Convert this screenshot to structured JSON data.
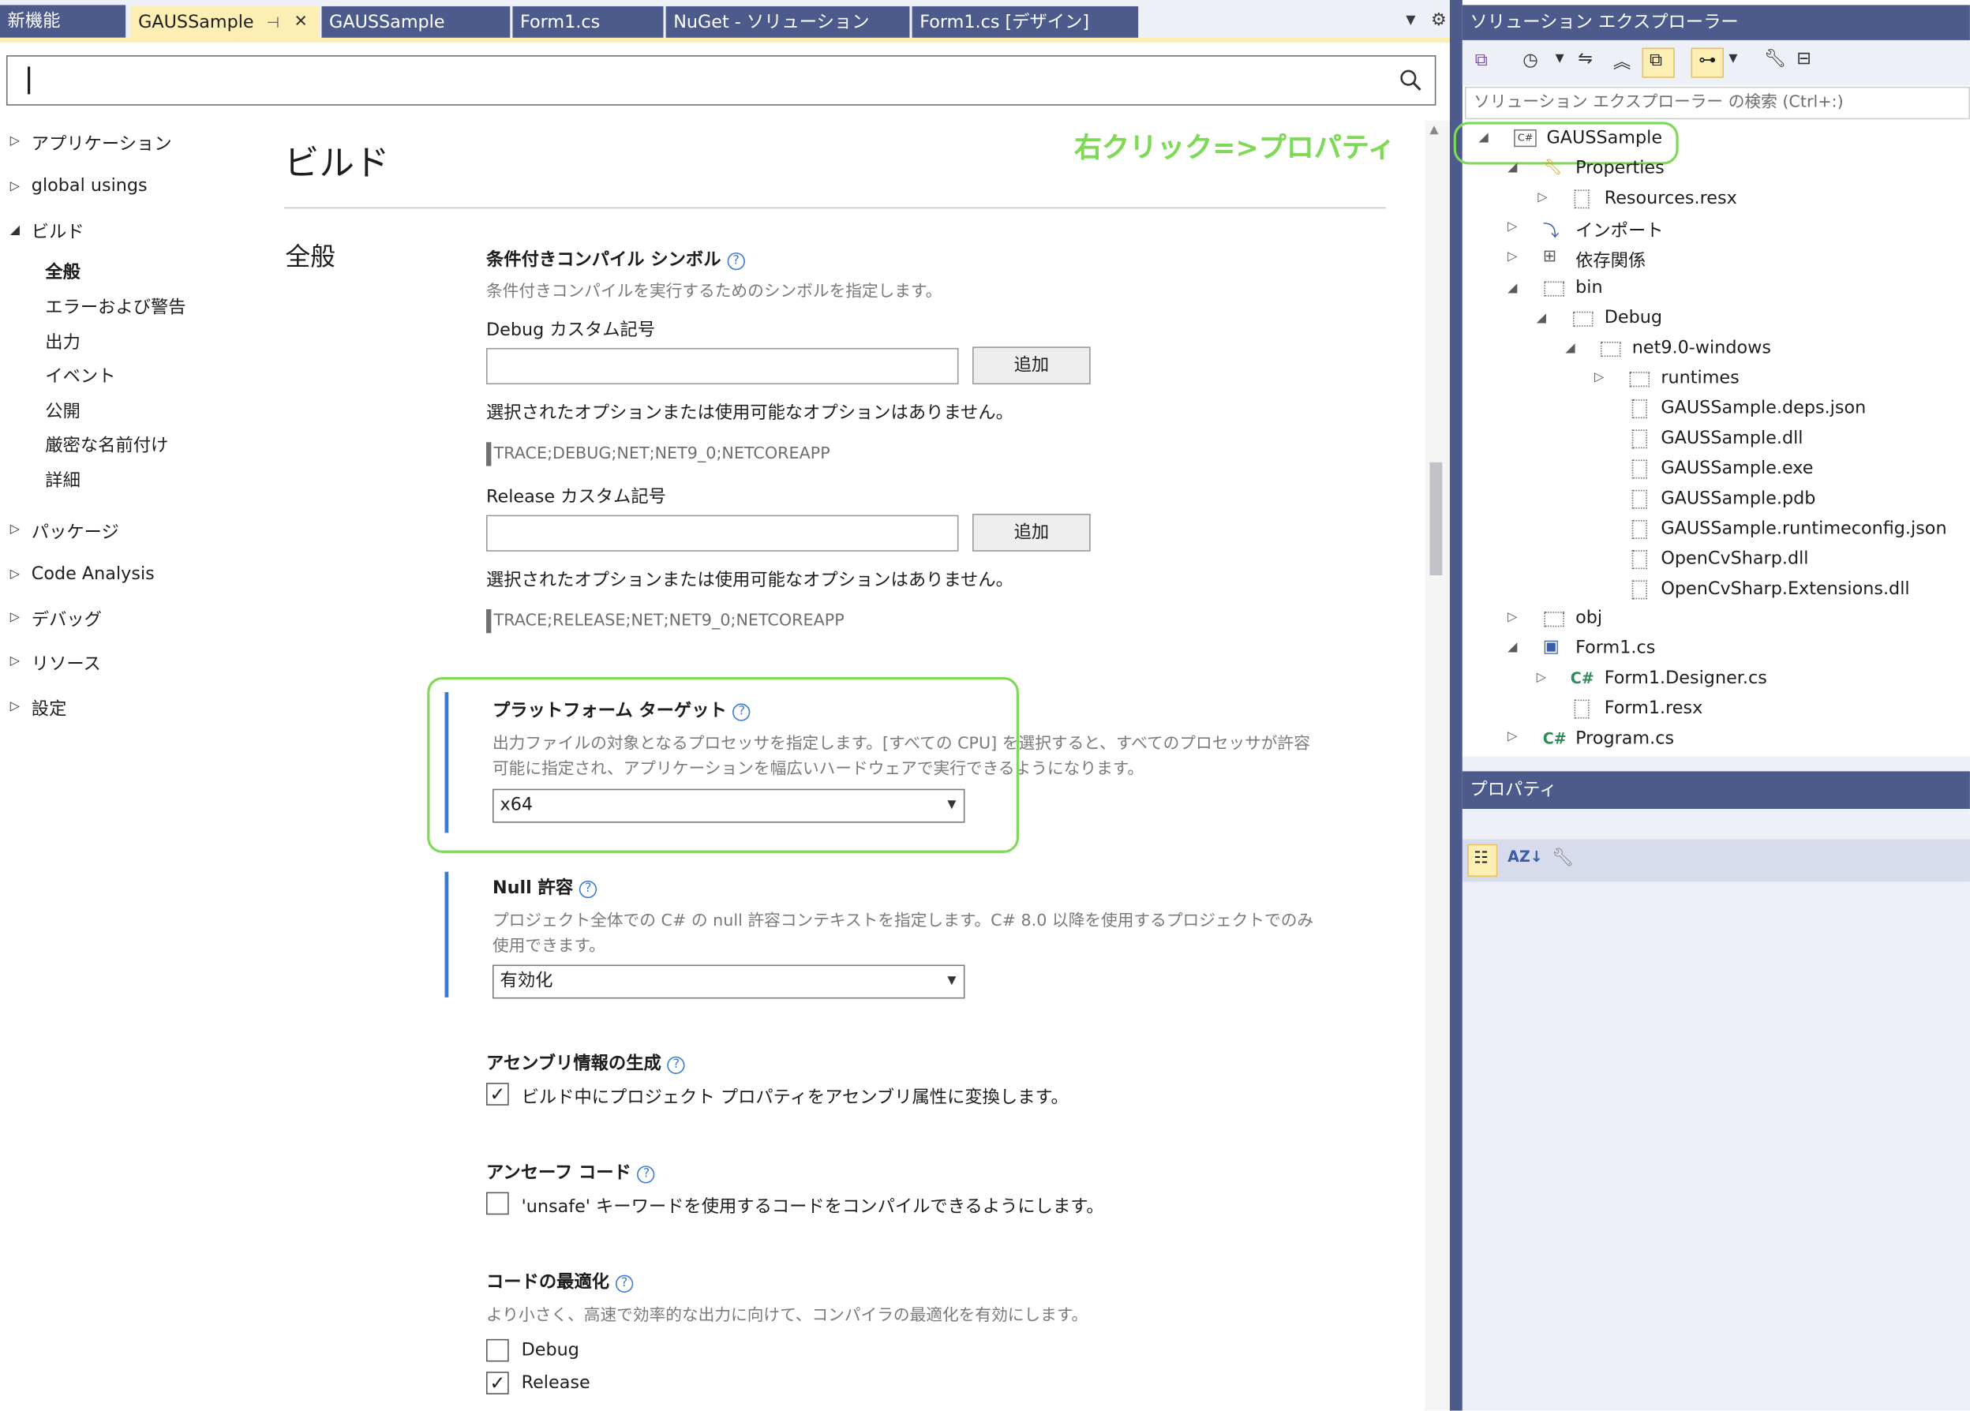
{
  "tabs": [
    "新機能",
    "GAUSSample",
    "GAUSSample",
    "Form1.cs",
    "NuGet - ソリューション",
    "Form1.cs [デザイン]"
  ],
  "tab_pin": "⊣",
  "tab_close": "✕",
  "nav": {
    "items": [
      {
        "label": "アプリケーション",
        "expanded": false
      },
      {
        "label": "global usings",
        "expanded": false
      },
      {
        "label": "ビルド",
        "expanded": true
      },
      {
        "label": "パッケージ",
        "expanded": false
      },
      {
        "label": "Code Analysis",
        "expanded": false
      },
      {
        "label": "デバッグ",
        "expanded": false
      },
      {
        "label": "リソース",
        "expanded": false
      },
      {
        "label": "設定",
        "expanded": false
      }
    ],
    "build_children": [
      "全般",
      "エラーおよび警告",
      "出力",
      "イベント",
      "公開",
      "厳密な名前付け",
      "詳細"
    ],
    "selected": "全般"
  },
  "page": {
    "title": "ビルド",
    "section": "全般"
  },
  "annotation": "右クリック=>プロパティ",
  "settings": {
    "cond": {
      "title": "条件付きコンパイル シンボル",
      "desc": "条件付きコンパイルを実行するためのシンボルを指定します。"
    },
    "debug": {
      "label": "Debug カスタム記号",
      "add": "追加",
      "none": "選択されたオプションまたは使用可能なオプションはありません。",
      "symbols": "TRACE;DEBUG;NET;NET9_0;NETCOREAPP"
    },
    "release": {
      "label": "Release カスタム記号",
      "add": "追加",
      "none": "選択されたオプションまたは使用可能なオプションはありません。",
      "symbols": "TRACE;RELEASE;NET;NET9_0;NETCOREAPP"
    },
    "platform": {
      "title": "プラットフォーム ターゲット",
      "desc1": "出力ファイルの対象となるプロセッサを指定します。[すべての CPU] を選択すると、すべてのプロセッサが許容",
      "desc2": "可能に指定され、アプリケーションを幅広いハードウェアで実行できるようになります。",
      "value": "x64"
    },
    "nullable": {
      "title": "Null 許容",
      "desc1": "プロジェクト全体での C# の null 許容コンテキストを指定します。C# 8.0 以降を使用するプロジェクトでのみ",
      "desc2": "使用できます。",
      "value": "有効化"
    },
    "assembly": {
      "title": "アセンブリ情報の生成",
      "check_label": "ビルド中にプロジェクト プロパティをアセンブリ属性に変換します。",
      "checked": true
    },
    "unsafe": {
      "title": "アンセーフ コード",
      "check_label": "'unsafe' キーワードを使用するコードをコンパイルできるようにします。",
      "checked": false
    },
    "optimize": {
      "title": "コードの最適化",
      "desc": "より小さく、高速で効率的な出力に向けて、コンパイラの最適化を有効にします。",
      "debug_label": "Debug",
      "debug_checked": false,
      "release_label": "Release",
      "release_checked": true
    }
  },
  "solution_explorer": {
    "title": "ソリューション エクスプローラー",
    "search_placeholder": "ソリューション エクスプローラー の検索 (Ctrl+:)",
    "tree": {
      "project": "GAUSSample",
      "properties": "Properties",
      "resources": "Resources.resx",
      "imports": "インポート",
      "deps": "依存関係",
      "bin": "bin",
      "debug": "Debug",
      "net": "net9.0-windows",
      "runtimes": "runtimes",
      "files": [
        "GAUSSample.deps.json",
        "GAUSSample.dll",
        "GAUSSample.exe",
        "GAUSSample.pdb",
        "GAUSSample.runtimeconfig.json",
        "OpenCvSharp.dll",
        "OpenCvSharp.Extensions.dll"
      ],
      "obj": "obj",
      "form1": "Form1.cs",
      "designer": "Form1.Designer.cs",
      "form1resx": "Form1.resx",
      "program": "Program.cs"
    }
  },
  "properties": {
    "title": "プロパティ"
  },
  "icons": {
    "search": "search-icon",
    "help": "help-icon",
    "gear": "gear-icon"
  },
  "colors": {
    "accent": "#4d5b8c",
    "active_tab": "#fdeeb3",
    "annotation": "#7ed957",
    "help": "#3a7bd5"
  }
}
